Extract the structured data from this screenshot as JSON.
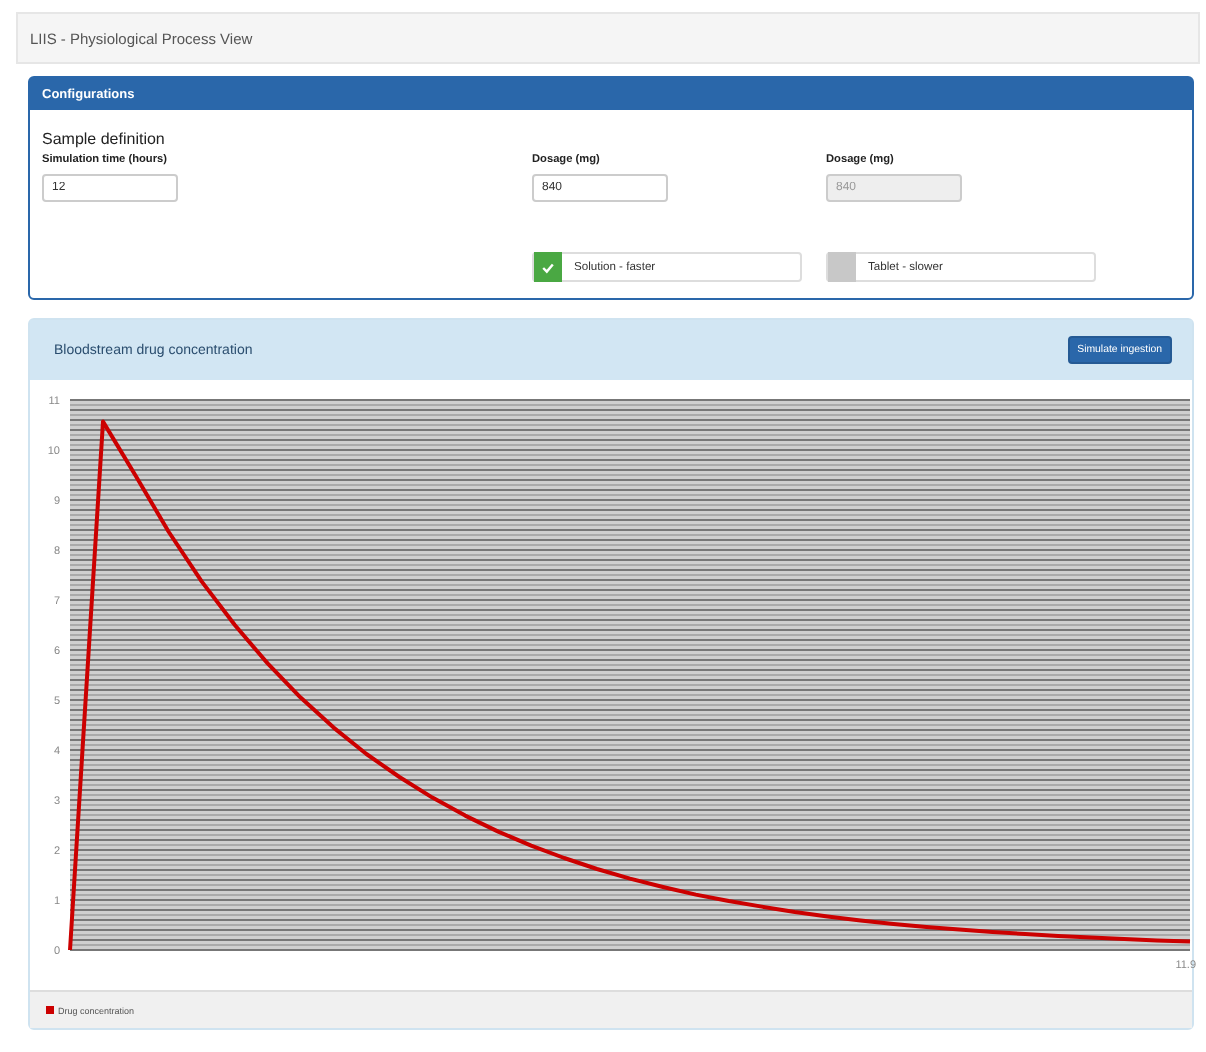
{
  "navbar": {
    "title": "LIIS - Physiological Process View"
  },
  "config_panel": {
    "title": "Configurations",
    "section": "Sample definition",
    "fields": [
      {
        "label": "Simulation time (hours)",
        "value": "12",
        "disabled": false
      },
      {
        "label": "Dosage (mg)",
        "value": "840",
        "disabled": false
      },
      {
        "label": "Dosage (mg)",
        "value": "840",
        "disabled": true
      }
    ],
    "options": [
      {
        "label": "Solution - faster",
        "checked": true
      },
      {
        "label": "Tablet - slower",
        "checked": false
      }
    ]
  },
  "chart_panel": {
    "title": "Bloodstream drug concentration",
    "button": "Simulate ingestion",
    "chart_data": {
      "type": "line",
      "series": [
        {
          "name": "Drug concentration",
          "color": "#cc0000",
          "values": [
            0,
            10.57,
            9.48,
            8.36,
            7.37,
            6.5,
            5.73,
            5.05,
            4.45,
            3.92,
            3.46,
            3.05,
            2.69,
            2.37,
            2.09,
            1.84,
            1.62,
            1.43,
            1.26,
            1.11,
            0.98,
            0.87,
            0.76,
            0.67,
            0.59,
            0.52,
            0.46,
            0.41,
            0.36,
            0.32,
            0.28,
            0.25,
            0.22,
            0.19,
            0.17
          ]
        }
      ],
      "ylim": [
        0,
        11
      ],
      "yticks": [
        0,
        1,
        2,
        3,
        4,
        5,
        6,
        7,
        8,
        9,
        10,
        11
      ],
      "grid": true,
      "annotations": [
        {
          "text": "11.9"
        }
      ]
    }
  }
}
